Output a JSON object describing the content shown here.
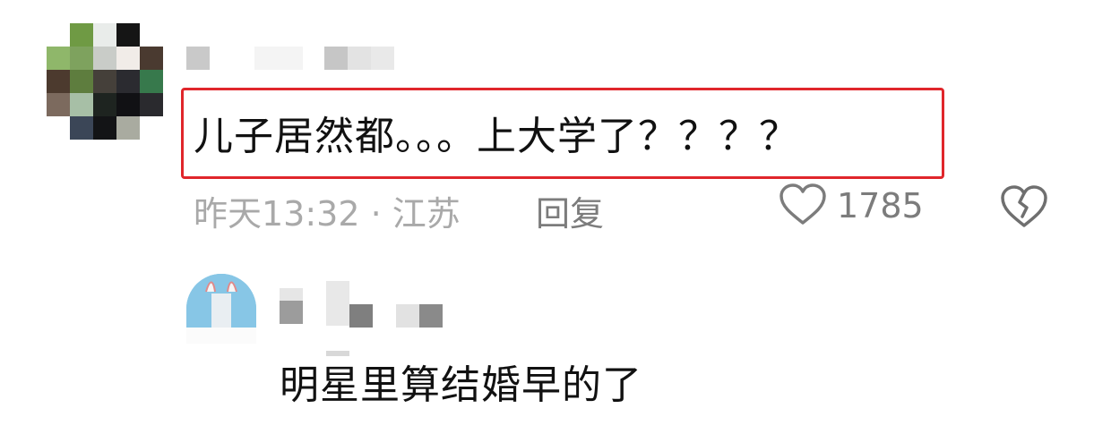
{
  "comment": {
    "text": "儿子居然都。。。上大学了？？？？",
    "time_location": "昨天13:32 · 江苏",
    "reply_label": "回复",
    "like_count": "1785",
    "highlight_color": "#e0262b"
  },
  "reply": {
    "text": "明星里算结婚早的了"
  },
  "icons": {
    "like": "heart-outline-icon",
    "dislike": "broken-heart-icon"
  }
}
